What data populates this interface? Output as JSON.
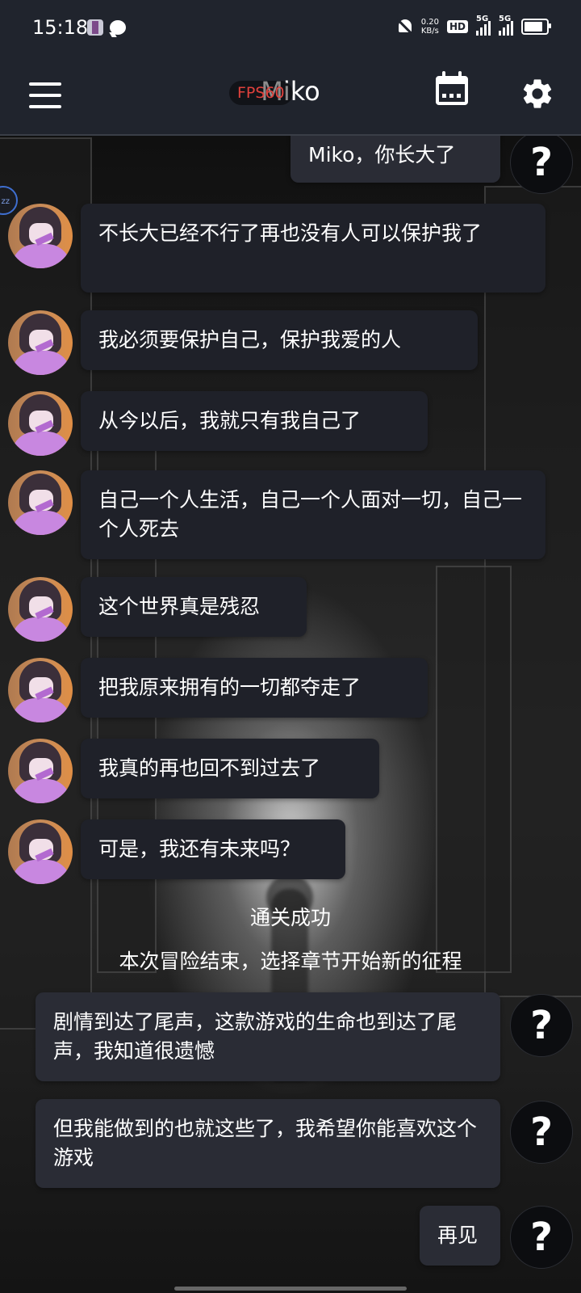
{
  "status_bar": {
    "time": "15:18",
    "net_speed_value": "0.20",
    "net_speed_unit": "KB/s",
    "hd_label": "HD",
    "sim1_network": "5G",
    "sim2_network": "5G"
  },
  "app_bar": {
    "title": "Miko",
    "fps_label": "FPS",
    "fps_value": "60"
  },
  "edge_badge": "zz",
  "messages": [
    {
      "side": "right",
      "text": "Miko，你长大了"
    },
    {
      "side": "left",
      "text": "不长大已经不行了再也没有人可以保护我了"
    },
    {
      "side": "left",
      "text": "我必须要保护自己，保护我爱的人"
    },
    {
      "side": "left",
      "text": "从今以后，我就只有我自己了"
    },
    {
      "side": "left",
      "text": "自己一个人生活，自己一个人面对一切，自己一个人死去"
    },
    {
      "side": "left",
      "text": "这个世界真是残忍"
    },
    {
      "side": "left",
      "text": "把我原来拥有的一切都夺走了"
    },
    {
      "side": "left",
      "text": "我真的再也回不到过去了"
    },
    {
      "side": "left",
      "text": "可是，我还有未来吗？"
    },
    {
      "side": "right",
      "text": "剧情到达了尾声，这款游戏的生命也到达了尾声，我知道很遗憾"
    },
    {
      "side": "right",
      "text": "但我能做到的也就这些了，我希望你能喜欢这个游戏"
    },
    {
      "side": "right",
      "text": "再见"
    }
  ],
  "system": {
    "title": "通关成功",
    "subtitle": "本次冒险结束，选择章节开始新的征程"
  },
  "user_icon_glyph": "?",
  "colors": {
    "bar_background": "#20242d",
    "bubble_background": "#1f2129",
    "fps_text": "#e0413c"
  }
}
